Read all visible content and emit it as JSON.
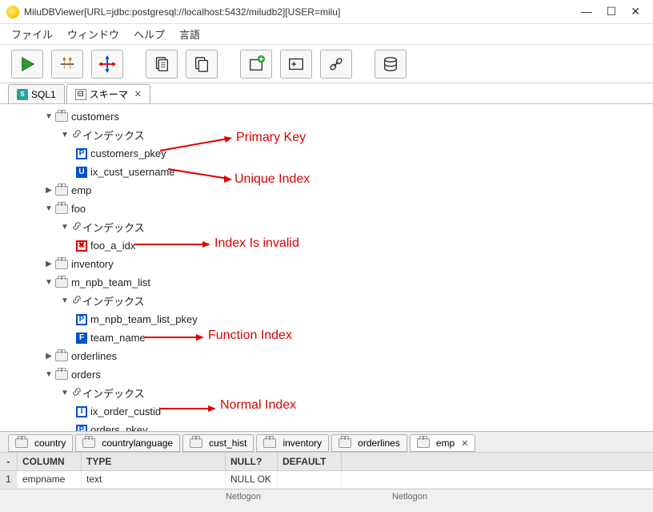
{
  "window": {
    "title": "MiluDBViewer[URL=jdbc:postgresql://localhost:5432/miludb2][USER=milu]"
  },
  "menu": {
    "file": "ファイル",
    "window": "ウィンドウ",
    "help": "ヘルプ",
    "lang": "言語"
  },
  "tabs": {
    "sql": "SQL1",
    "schema": "スキーマ"
  },
  "tree": {
    "customers": "customers",
    "index_label": "インデックス",
    "customers_pkey": "customers_pkey",
    "ix_cust_username": "ix_cust_username",
    "emp": "emp",
    "foo": "foo",
    "foo_a_idx": "foo_a_idx",
    "inventory": "inventory",
    "m_npb_team_list": "m_npb_team_list",
    "m_npb_team_list_pkey": "m_npb_team_list_pkey",
    "team_name": "team_name",
    "orderlines": "orderlines",
    "orders": "orders",
    "ix_order_custid": "ix_order_custid",
    "orders_pkey": "orders_pkey"
  },
  "annotations": {
    "primary_key": "Primary Key",
    "unique_index": "Unique Index",
    "invalid": "Index Is invalid",
    "function": "Function Index",
    "normal": "Normal Index"
  },
  "bottom_tabs": {
    "country": "country",
    "countrylanguage": "countrylanguage",
    "cust_hist": "cust_hist",
    "inventory": "inventory",
    "orderlines": "orderlines",
    "emp": "emp"
  },
  "grid": {
    "headers": {
      "num": "-",
      "column": "COLUMN",
      "type": "TYPE",
      "null": "NULL?",
      "default": "DEFAULT"
    },
    "row1": {
      "num": "1",
      "column": "empname",
      "type": "text",
      "null": "NULL OK",
      "default": ""
    }
  },
  "footer": {
    "netlogon1": "Netlogon",
    "netlogon2": "Netlogon"
  }
}
